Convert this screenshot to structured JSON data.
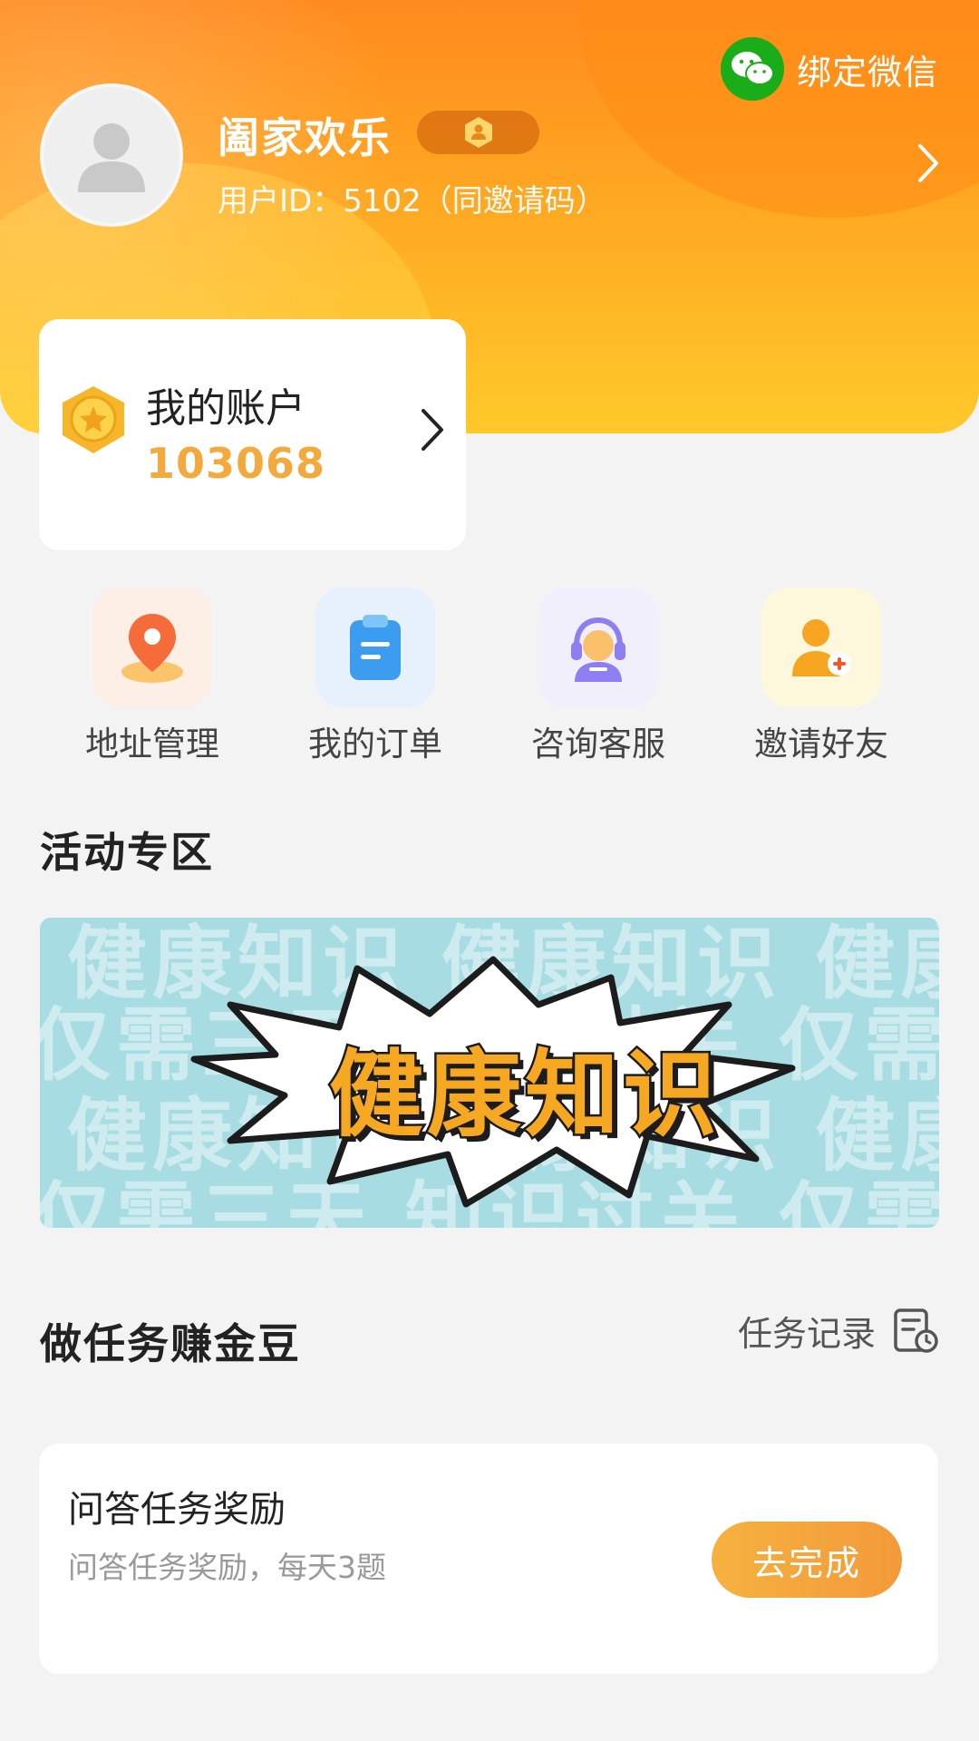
{
  "header": {
    "bind_wechat_label": "绑定微信",
    "username": "阖家欢乐",
    "user_id_text": "用户ID：5102（同邀请码）"
  },
  "account": {
    "title": "我的账户",
    "value": "103068"
  },
  "quick_menu": [
    {
      "label": "地址管理",
      "icon": "location-pin-icon"
    },
    {
      "label": "我的订单",
      "icon": "clipboard-icon"
    },
    {
      "label": "咨询客服",
      "icon": "customer-service-icon"
    },
    {
      "label": "邀请好友",
      "icon": "add-friend-icon"
    }
  ],
  "activity": {
    "title": "活动专区",
    "banner": {
      "headline": "健康知识",
      "bg_rows": [
        "健康知识   健康知识   健康知识",
        "仅需三天   知识过关   仅需三天",
        "健康知识   健康知识   健康知识",
        "仅需三天   知识过关   仅需三天"
      ]
    }
  },
  "tasks": {
    "title": "做任务赚金豆",
    "record_label": "任务记录",
    "items": [
      {
        "title": "问答任务奖励",
        "desc": "问答任务奖励，每天3题",
        "button": "去完成"
      }
    ]
  },
  "colors": {
    "header_top": "#ff8a1e",
    "header_bottom": "#ffc92a",
    "accent_gold": "#f3a93c",
    "wechat_green": "#1aad19",
    "banner_bg": "#a7dde2"
  }
}
